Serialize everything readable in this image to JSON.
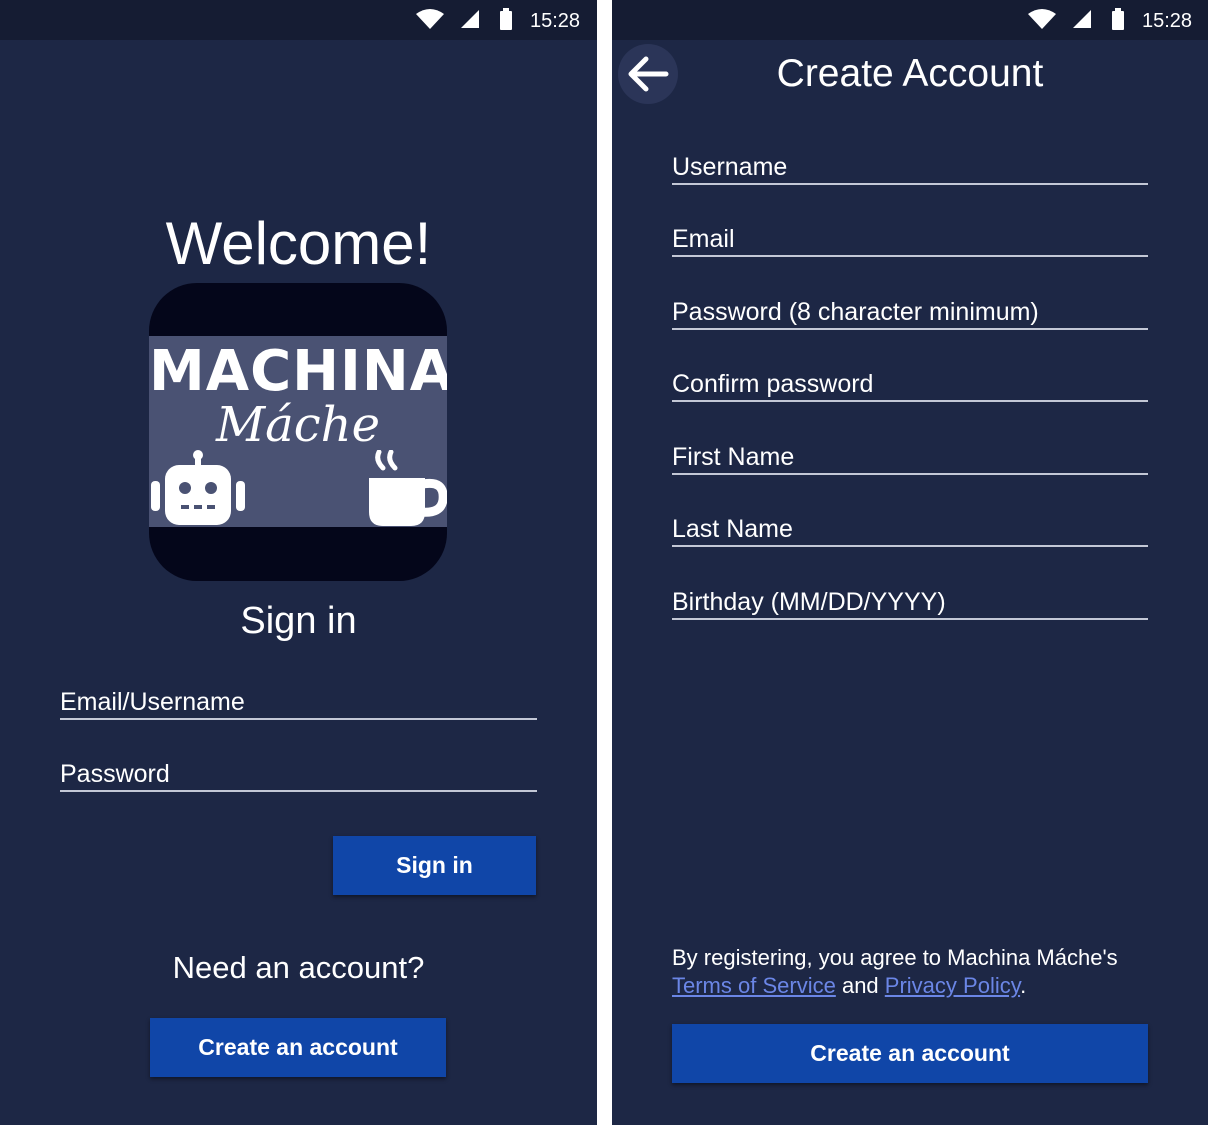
{
  "status_bar": {
    "time": "15:28"
  },
  "signin_screen": {
    "welcome": "Welcome!",
    "logo": {
      "title": "MACHINA",
      "subtitle": "Máche",
      "icons": [
        "robot-icon",
        "coffee-cup-icon"
      ]
    },
    "heading": "Sign in",
    "fields": {
      "email_username_placeholder": "Email/Username",
      "password_placeholder": "Password"
    },
    "signin_button": "Sign in",
    "need_account": "Need an account?",
    "create_account_button": "Create an account"
  },
  "create_account_screen": {
    "back_icon": "arrow-left-icon",
    "title": "Create Account",
    "fields": {
      "username": "Username",
      "email": "Email",
      "password": "Password (8 character minimum)",
      "confirm_password": "Confirm password",
      "first_name": "First Name",
      "last_name": "Last Name",
      "birthday": "Birthday (MM/DD/YYYY)"
    },
    "terms": {
      "prefix": "By registering, you agree to Machina Máche's",
      "terms_link": "Terms of Service",
      "and": "and",
      "privacy_link": "Privacy Policy",
      "suffix": "."
    },
    "create_account_button": "Create an account"
  },
  "colors": {
    "background": "#1d2745",
    "status_bar": "#151c33",
    "button": "#1046a8",
    "link": "#6b86e6",
    "logo_dark": "#04061a",
    "logo_band": "#4a5273"
  }
}
